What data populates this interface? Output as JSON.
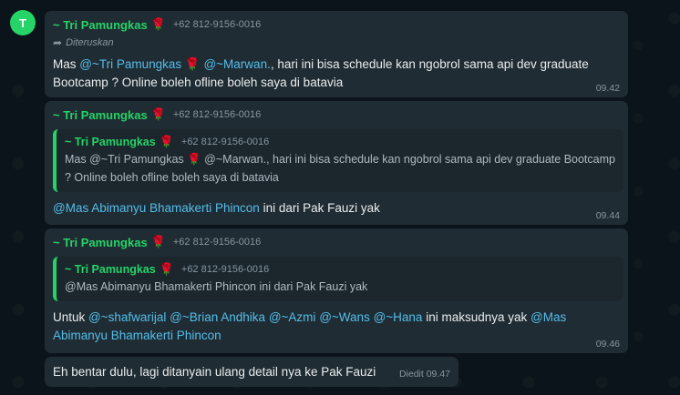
{
  "avatar": {
    "initial": "T"
  },
  "messages": [
    {
      "sender": "~ Tri Pamungkas",
      "emoji": "🌹",
      "phone": "+62 812-9156-0016",
      "forwarded_label": "Diteruskan",
      "text_parts": [
        "Mas ",
        "@~Tri Pamungkas 🌹",
        " ",
        "@~Marwan.",
        ", hari ini bisa schedule kan ngobrol sama api dev graduate Bootcamp ? Online boleh ofline boleh saya di batavia"
      ],
      "time": "09.42"
    },
    {
      "sender": "~ Tri Pamungkas",
      "emoji": "🌹",
      "phone": "+62 812-9156-0016",
      "quote": {
        "sender": "~ Tri Pamungkas",
        "emoji": "🌹",
        "phone": "+62 812-9156-0016",
        "text": "Mas  @~Tri Pamungkas 🌹 @~Marwan., hari ini bisa schedule kan ngobrol sama api dev graduate Bootcamp ? Online boleh ofline boleh saya di batavia"
      },
      "mention": "@Mas Abimanyu Bhamakerti Phincon",
      "text": " ini dari Pak Fauzi yak",
      "time": "09.44"
    },
    {
      "sender": "~ Tri Pamungkas",
      "emoji": "🌹",
      "phone": "+62 812-9156-0016",
      "quote": {
        "sender": "~ Tri Pamungkas",
        "emoji": "🌹",
        "phone": "+62 812-9156-0016",
        "text": "@Mas Abimanyu Bhamakerti Phincon ini dari Pak Fauzi yak"
      },
      "text_parts": [
        "Untuk ",
        "@~shafwarijal",
        " ",
        "@~Brian Andhika",
        " ",
        "@~Azmi",
        " ",
        "@~Wans",
        " ",
        "@~Hana",
        " ini maksudnya yak ",
        "@Mas Abimanyu Bhamakerti Phincon"
      ],
      "time": "09.46"
    },
    {
      "text": "Eh bentar dulu, lagi ditanyain ulang detail nya ke Pak Fauzi",
      "edited_label": "Diedit",
      "time": "09.47"
    }
  ],
  "colors": {
    "sender": "#25d366",
    "mention": "#53bdeb",
    "bubble": "#202c33",
    "background": "#0b141a"
  },
  "icons": {
    "forward": "forward-arrow-icon",
    "rose": "rose-emoji-icon"
  }
}
